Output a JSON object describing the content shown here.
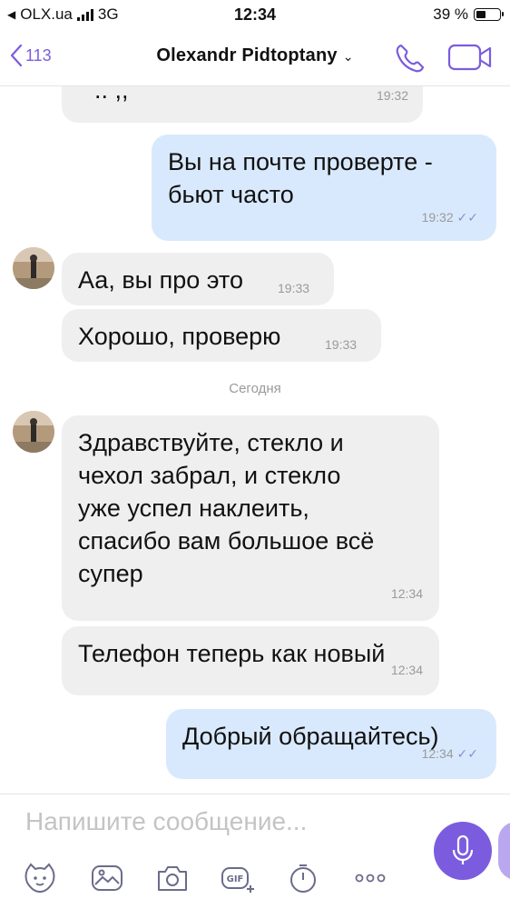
{
  "status_bar": {
    "carrier": "OLX.ua",
    "network": "3G",
    "time": "12:34",
    "battery": "39 %"
  },
  "header": {
    "back_count": "113",
    "contact_name": "Olexandr Pidtoptany",
    "chevron": "⌄",
    "icons": [
      "back-chevron-icon",
      "phone-icon",
      "video-camera-icon"
    ]
  },
  "messages": [
    {
      "direction": "in",
      "text": "",
      "time": "19:32"
    },
    {
      "direction": "out",
      "lines": [
        "Вы на почте проверте -",
        "бьют часто"
      ],
      "time": "19:32",
      "read": true
    },
    {
      "direction": "in",
      "text": "Аа, вы про это",
      "time": "19:33"
    },
    {
      "direction": "in",
      "text": "Хорошо, проверю",
      "time": "19:33"
    },
    {
      "direction": "in",
      "lines": [
        "Здравствуйте, стекло и",
        "чехол забрал, и стекло",
        "уже успел наклеить,",
        "спасибо вам большое всё",
        "супер"
      ],
      "time": "12:34"
    },
    {
      "direction": "in",
      "text": "Телефон теперь как новый",
      "time": "12:34"
    },
    {
      "direction": "out",
      "text": "Добрый обращайтесь)",
      "time": "12:34",
      "read": true
    }
  ],
  "date_separator": "Сегодня",
  "input": {
    "placeholder": "Напишите сообщение..."
  },
  "toolbar_icons": [
    "sticker-icon",
    "gallery-icon",
    "camera-icon",
    "gif-icon",
    "timer-icon",
    "more-icon"
  ],
  "colors": {
    "accent": "#7b5cde",
    "outgoing_bubble": "#d9e9fd",
    "incoming_bubble": "#efefef"
  }
}
